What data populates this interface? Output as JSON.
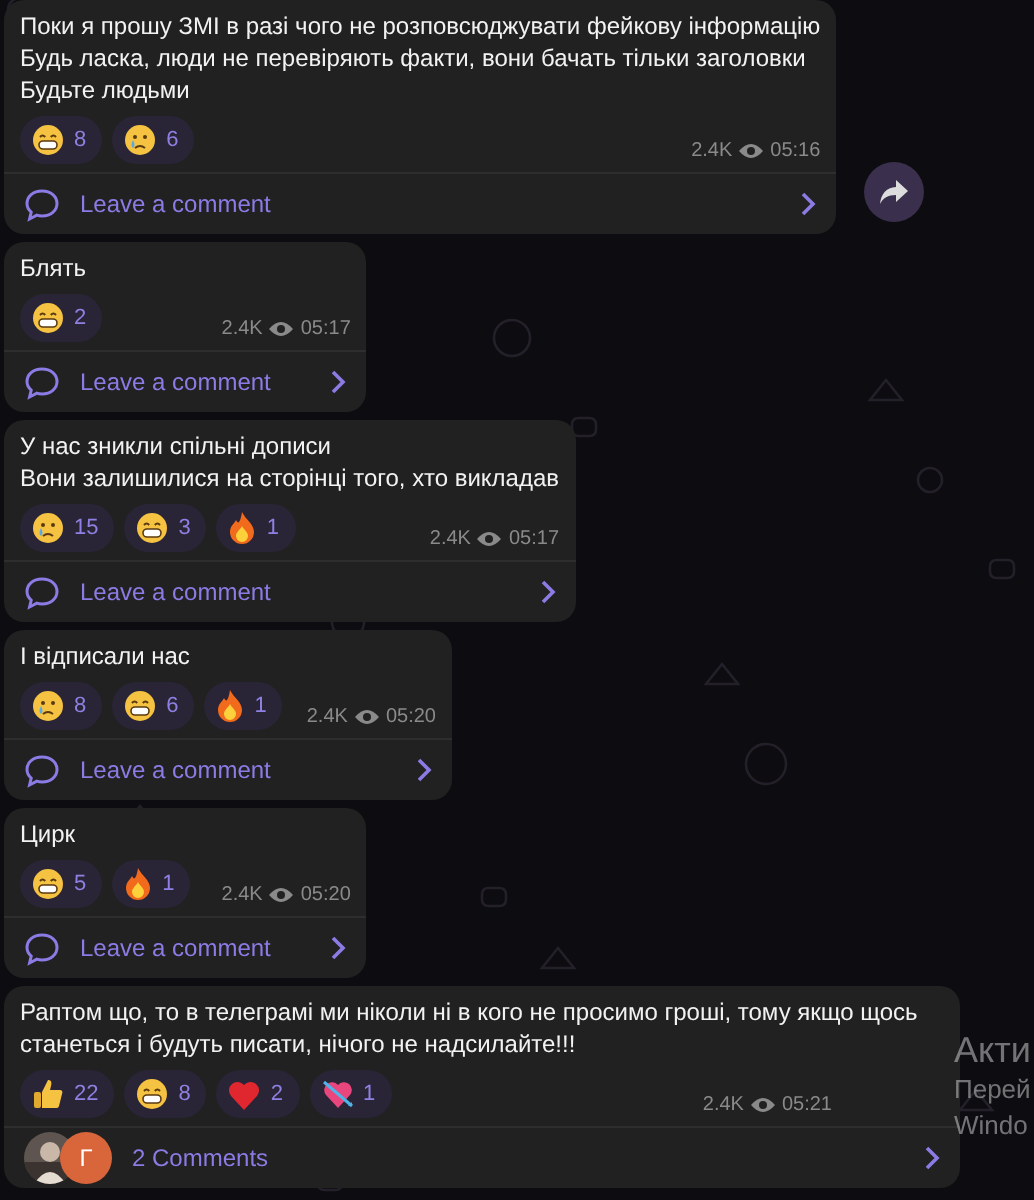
{
  "messages": [
    {
      "lines": [
        "Поки я прошу ЗМІ в разі чого не розповсюджувати фейкову інформацію",
        "Будь ласка, люди не перевіряють факти, вони бачать тільки заголовки",
        "Будьте людьми"
      ],
      "reactions": [
        {
          "kind": "grin",
          "count": "8"
        },
        {
          "kind": "cry",
          "count": "6"
        }
      ],
      "views": "2.4K",
      "time": "05:16",
      "comments": {
        "kind": "leave",
        "label": "Leave a comment"
      },
      "forward_button": true
    },
    {
      "lines": [
        "Блять"
      ],
      "reactions": [
        {
          "kind": "grin",
          "count": "2"
        }
      ],
      "views": "2.4K",
      "time": "05:17",
      "comments": {
        "kind": "leave",
        "label": "Leave a comment"
      }
    },
    {
      "lines": [
        "У нас зникли спільні дописи",
        "Вони залишилися на сторінці того, хто викладав"
      ],
      "reactions": [
        {
          "kind": "cry",
          "count": "15"
        },
        {
          "kind": "grin",
          "count": "3"
        },
        {
          "kind": "fire",
          "count": "1"
        }
      ],
      "views": "2.4K",
      "time": "05:17",
      "comments": {
        "kind": "leave",
        "label": "Leave a comment"
      }
    },
    {
      "lines": [
        "І відписали нас"
      ],
      "reactions": [
        {
          "kind": "cry",
          "count": "8"
        },
        {
          "kind": "grin",
          "count": "6"
        },
        {
          "kind": "fire",
          "count": "1"
        }
      ],
      "views": "2.4K",
      "time": "05:20",
      "comments": {
        "kind": "leave",
        "label": "Leave a comment"
      }
    },
    {
      "lines": [
        "Цирк"
      ],
      "reactions": [
        {
          "kind": "grin",
          "count": "5"
        },
        {
          "kind": "fire",
          "count": "1"
        }
      ],
      "views": "2.4K",
      "time": "05:20",
      "comments": {
        "kind": "leave",
        "label": "Leave a comment"
      }
    },
    {
      "lines": [
        "Раптом що, то в телеграмі ми ніколи ні в кого не просимо гроші, тому якщо щось станеться і будуть писати, нічого не надсилайте!!!"
      ],
      "reactions": [
        {
          "kind": "thumbs",
          "count": "22"
        },
        {
          "kind": "grin",
          "count": "8"
        },
        {
          "kind": "heart",
          "count": "2"
        },
        {
          "kind": "heart_arrow",
          "count": "1"
        }
      ],
      "views": "2.4K",
      "time": "05:21",
      "comments": {
        "kind": "count",
        "label": "2 Comments",
        "avatars": [
          {
            "kind": "picture"
          },
          {
            "kind": "initials",
            "initials": "Г"
          }
        ]
      }
    }
  ],
  "activation_notice": [
    "Акти",
    "Перей",
    "Windo"
  ]
}
